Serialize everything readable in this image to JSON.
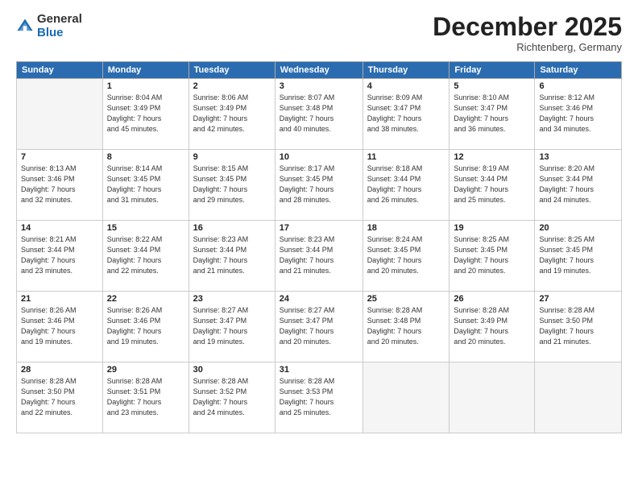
{
  "logo": {
    "general": "General",
    "blue": "Blue"
  },
  "title": "December 2025",
  "subtitle": "Richtenberg, Germany",
  "headers": [
    "Sunday",
    "Monday",
    "Tuesday",
    "Wednesday",
    "Thursday",
    "Friday",
    "Saturday"
  ],
  "weeks": [
    [
      {
        "num": "",
        "info": ""
      },
      {
        "num": "1",
        "info": "Sunrise: 8:04 AM\nSunset: 3:49 PM\nDaylight: 7 hours\nand 45 minutes."
      },
      {
        "num": "2",
        "info": "Sunrise: 8:06 AM\nSunset: 3:49 PM\nDaylight: 7 hours\nand 42 minutes."
      },
      {
        "num": "3",
        "info": "Sunrise: 8:07 AM\nSunset: 3:48 PM\nDaylight: 7 hours\nand 40 minutes."
      },
      {
        "num": "4",
        "info": "Sunrise: 8:09 AM\nSunset: 3:47 PM\nDaylight: 7 hours\nand 38 minutes."
      },
      {
        "num": "5",
        "info": "Sunrise: 8:10 AM\nSunset: 3:47 PM\nDaylight: 7 hours\nand 36 minutes."
      },
      {
        "num": "6",
        "info": "Sunrise: 8:12 AM\nSunset: 3:46 PM\nDaylight: 7 hours\nand 34 minutes."
      }
    ],
    [
      {
        "num": "7",
        "info": "Sunrise: 8:13 AM\nSunset: 3:46 PM\nDaylight: 7 hours\nand 32 minutes."
      },
      {
        "num": "8",
        "info": "Sunrise: 8:14 AM\nSunset: 3:45 PM\nDaylight: 7 hours\nand 31 minutes."
      },
      {
        "num": "9",
        "info": "Sunrise: 8:15 AM\nSunset: 3:45 PM\nDaylight: 7 hours\nand 29 minutes."
      },
      {
        "num": "10",
        "info": "Sunrise: 8:17 AM\nSunset: 3:45 PM\nDaylight: 7 hours\nand 28 minutes."
      },
      {
        "num": "11",
        "info": "Sunrise: 8:18 AM\nSunset: 3:44 PM\nDaylight: 7 hours\nand 26 minutes."
      },
      {
        "num": "12",
        "info": "Sunrise: 8:19 AM\nSunset: 3:44 PM\nDaylight: 7 hours\nand 25 minutes."
      },
      {
        "num": "13",
        "info": "Sunrise: 8:20 AM\nSunset: 3:44 PM\nDaylight: 7 hours\nand 24 minutes."
      }
    ],
    [
      {
        "num": "14",
        "info": "Sunrise: 8:21 AM\nSunset: 3:44 PM\nDaylight: 7 hours\nand 23 minutes."
      },
      {
        "num": "15",
        "info": "Sunrise: 8:22 AM\nSunset: 3:44 PM\nDaylight: 7 hours\nand 22 minutes."
      },
      {
        "num": "16",
        "info": "Sunrise: 8:23 AM\nSunset: 3:44 PM\nDaylight: 7 hours\nand 21 minutes."
      },
      {
        "num": "17",
        "info": "Sunrise: 8:23 AM\nSunset: 3:44 PM\nDaylight: 7 hours\nand 21 minutes."
      },
      {
        "num": "18",
        "info": "Sunrise: 8:24 AM\nSunset: 3:45 PM\nDaylight: 7 hours\nand 20 minutes."
      },
      {
        "num": "19",
        "info": "Sunrise: 8:25 AM\nSunset: 3:45 PM\nDaylight: 7 hours\nand 20 minutes."
      },
      {
        "num": "20",
        "info": "Sunrise: 8:25 AM\nSunset: 3:45 PM\nDaylight: 7 hours\nand 19 minutes."
      }
    ],
    [
      {
        "num": "21",
        "info": "Sunrise: 8:26 AM\nSunset: 3:46 PM\nDaylight: 7 hours\nand 19 minutes."
      },
      {
        "num": "22",
        "info": "Sunrise: 8:26 AM\nSunset: 3:46 PM\nDaylight: 7 hours\nand 19 minutes."
      },
      {
        "num": "23",
        "info": "Sunrise: 8:27 AM\nSunset: 3:47 PM\nDaylight: 7 hours\nand 19 minutes."
      },
      {
        "num": "24",
        "info": "Sunrise: 8:27 AM\nSunset: 3:47 PM\nDaylight: 7 hours\nand 20 minutes."
      },
      {
        "num": "25",
        "info": "Sunrise: 8:28 AM\nSunset: 3:48 PM\nDaylight: 7 hours\nand 20 minutes."
      },
      {
        "num": "26",
        "info": "Sunrise: 8:28 AM\nSunset: 3:49 PM\nDaylight: 7 hours\nand 20 minutes."
      },
      {
        "num": "27",
        "info": "Sunrise: 8:28 AM\nSunset: 3:50 PM\nDaylight: 7 hours\nand 21 minutes."
      }
    ],
    [
      {
        "num": "28",
        "info": "Sunrise: 8:28 AM\nSunset: 3:50 PM\nDaylight: 7 hours\nand 22 minutes."
      },
      {
        "num": "29",
        "info": "Sunrise: 8:28 AM\nSunset: 3:51 PM\nDaylight: 7 hours\nand 23 minutes."
      },
      {
        "num": "30",
        "info": "Sunrise: 8:28 AM\nSunset: 3:52 PM\nDaylight: 7 hours\nand 24 minutes."
      },
      {
        "num": "31",
        "info": "Sunrise: 8:28 AM\nSunset: 3:53 PM\nDaylight: 7 hours\nand 25 minutes."
      },
      {
        "num": "",
        "info": ""
      },
      {
        "num": "",
        "info": ""
      },
      {
        "num": "",
        "info": ""
      }
    ]
  ]
}
